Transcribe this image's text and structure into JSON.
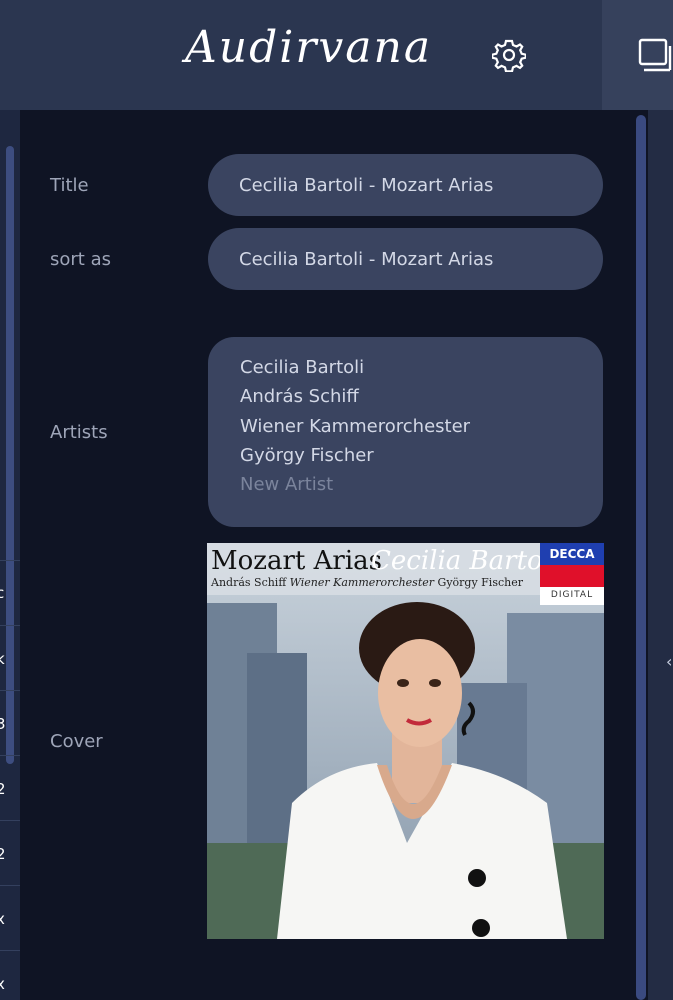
{
  "header": {
    "logo": "Audirvana",
    "settings_icon": "gear-icon",
    "display_icon": "display-icon"
  },
  "form": {
    "title_label": "Title",
    "title_value": "Cecilia Bartoli - Mozart Arias",
    "sort_label": "sort as",
    "sort_value": "Cecilia Bartoli - Mozart Arias",
    "artists_label": "Artists",
    "artists": [
      "Cecilia Bartoli",
      "András Schiff",
      "Wiener Kammerorchester",
      "György Fischer"
    ],
    "new_artist_placeholder": "New Artist",
    "cover_label": "Cover"
  },
  "cover": {
    "title": "Mozart Arias",
    "artist": "Cecilia Bartoli",
    "credit_1": "András Schiff",
    "credit_2": "Wiener Kammerorchester",
    "credit_3": "György Fischer",
    "label": "DECCA",
    "label_sub": "DIGITAL"
  },
  "left_strip": {
    "glyphs": [
      "c",
      "k",
      "3",
      "2",
      "2",
      "x",
      "x"
    ]
  },
  "right_strip": {
    "chevron": "‹"
  }
}
